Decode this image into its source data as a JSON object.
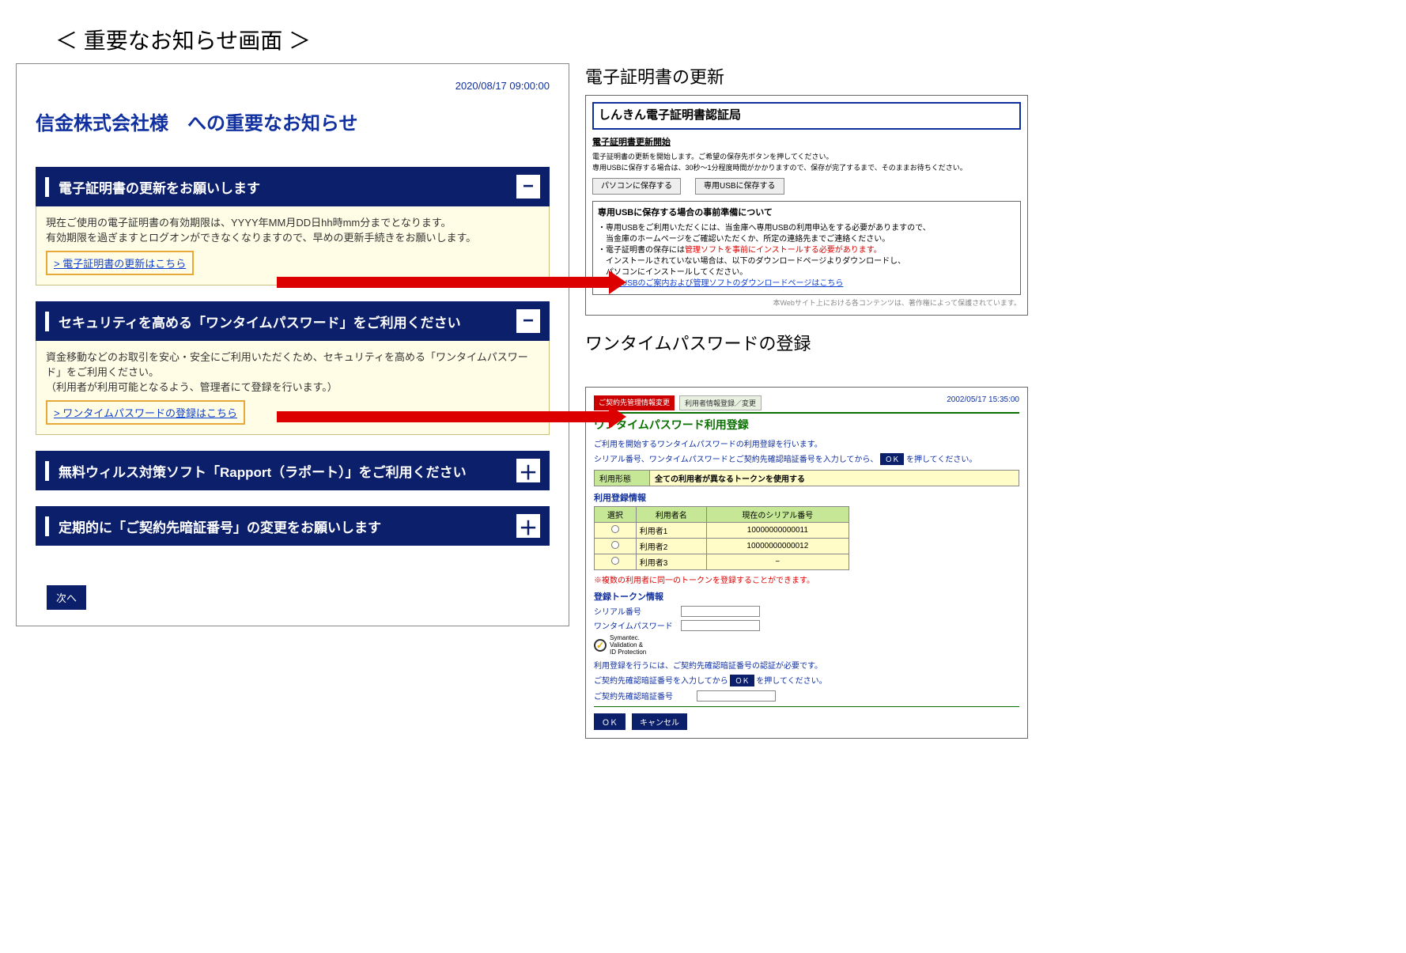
{
  "mainTitle": "＜ 重要なお知らせ画面 ＞",
  "timestamp": "2020/08/17 09:00:00",
  "noticeTitle": "信金株式会社様　への重要なお知らせ",
  "accordions": [
    {
      "title": "電子証明書の更新をお願いします",
      "toggle": "−",
      "body1": "現在ご使用の電子証明書の有効期限は、YYYY年MM月DD日hh時mm分までとなります。",
      "body2": "有効期限を過ぎますとログオンができなくなりますので、早めの更新手続きをお願いします。",
      "link": "> 電子証明書の更新はこちら"
    },
    {
      "title": "セキュリティを高める「ワンタイムパスワード」をご利用ください",
      "toggle": "−",
      "body1": "資金移動などのお取引を安心・安全にご利用いただくため、セキュリティを高める「ワンタイムパスワード」をご利用ください。",
      "body2": "（利用者が利用可能となるよう、管理者にて登録を行います。）",
      "link": "> ワンタイムパスワードの登録はこちら"
    },
    {
      "title": "無料ウィルス対策ソフト「Rapport（ラポート）」をご利用ください",
      "toggle": "＋"
    },
    {
      "title": "定期的に「ご契約先暗証番号」の変更をお願いします",
      "toggle": "＋"
    }
  ],
  "nextBtn": "次へ",
  "cert": {
    "heading": "電子証明書の更新",
    "panelTitle": "しんきん電子証明書認証局",
    "subhead": "電子証明書更新開始",
    "small1": "電子証明書の更新を開始します。ご希望の保存先ボタンを押してください。",
    "small2": "専用USBに保存する場合は、30秒～1分程度時間がかかりますので、保存が完了するまで、そのままお待ちください。",
    "btn1": "パソコンに保存する",
    "btn2": "専用USBに保存する",
    "boxTitle": "専用USBに保存する場合の事前準備について",
    "li1a": "・専用USBをご利用いただくには、当金庫へ専用USBの利用申込をする必要がありますので、",
    "li1b": "　当金庫のホームページをご確認いただくか、所定の連絡先までご連絡ください。",
    "li2": "・電子証明書の保存には管理ソフトを事前にインストールする必要があります。",
    "li2pre": "・電子証明書の保存には",
    "li2red": "管理ソフトを事前にインストールする必要があります。",
    "li3a": "　インストールされていない場合は、以下のダウンロードページよりダウンロードし、",
    "li3b": "　パソコンにインストールしてください。",
    "li4": "専用USBのご案内および管理ソフトのダウンロードページはこちら",
    "footer": "本Webサイト上における各コンテンツは、著作権によって保護されています。"
  },
  "otp": {
    "heading": "ワンタイムパスワードの登録",
    "tab1": "ご契約先管理情報変更",
    "tab2": "利用者情報登録／変更",
    "time": "2002/05/17  15:35:00",
    "title": "ワンタイムパスワード利用登録",
    "text1": "ご利用を開始するワンタイムパスワードの利用登録を行います。",
    "text2a": "シリアル番号、ワンタイムパスワードとご契約先確認暗証番号を入力してから、",
    "text2b": " を押してください。",
    "okSmall": "ＯＫ",
    "usageLabel": "利用形態",
    "usageVal": "全ての利用者が異なるトークンを使用する",
    "regInfoLabel": "利用登録情報",
    "th1": "選択",
    "th2": "利用者名",
    "th3": "現在のシリアル番号",
    "rows": [
      {
        "name": "利用者1",
        "serial": "10000000000011"
      },
      {
        "name": "利用者2",
        "serial": "10000000000012"
      },
      {
        "name": "利用者3",
        "serial": "−"
      }
    ],
    "note": "※複数の利用者に同一のトークンを登録することができます。",
    "tokenInfoLabel": "登録トークン情報",
    "serialLabel": "シリアル番号",
    "otpLabel": "ワンタイムパスワード",
    "sym1": "Symantec.",
    "sym2": "Validation &",
    "sym3": "ID Protection",
    "bottom1": "利用登録を行うには、ご契約先確認暗証番号の認証が必要です。",
    "bottom2a": "ご契約先確認暗証番号を入力してから ",
    "bottom2b": " を押してください。",
    "pinLabel": "ご契約先確認暗証番号",
    "btnOk": "ＯＫ",
    "btnCancel": "キャンセル"
  }
}
